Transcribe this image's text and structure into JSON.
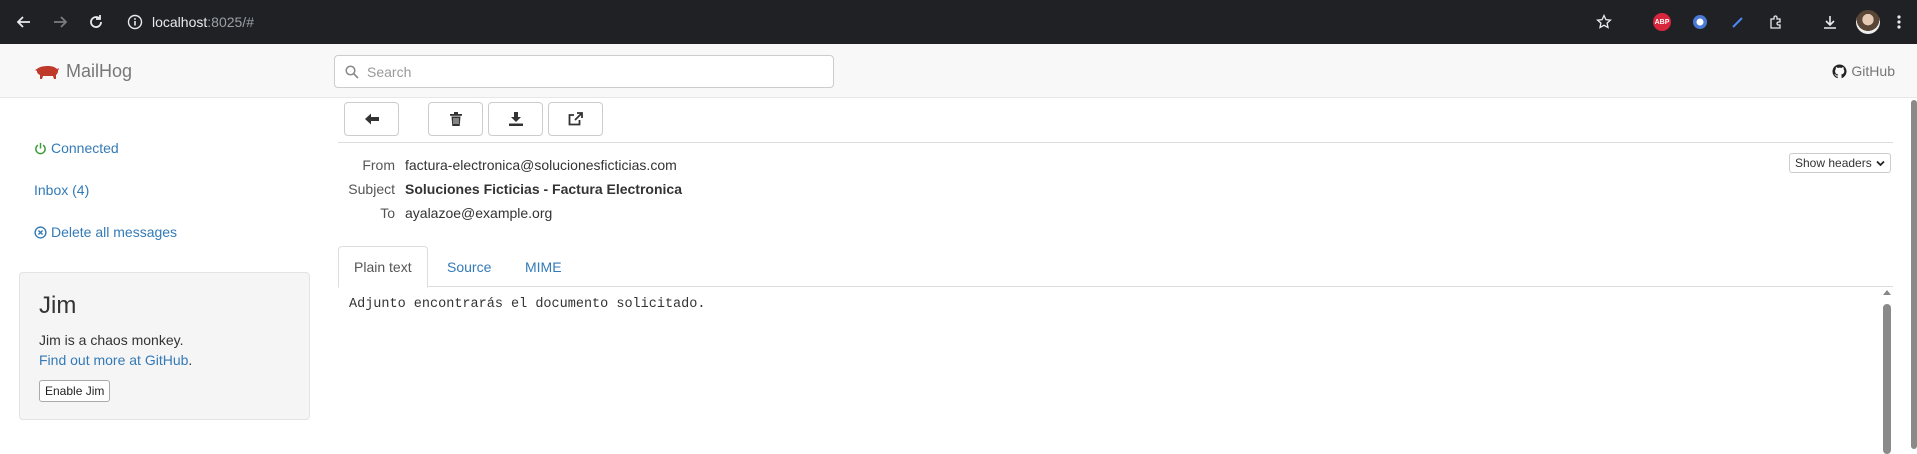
{
  "browser": {
    "url_host": "localhost",
    "url_rest": ":8025/#"
  },
  "app": {
    "brand": "MailHog",
    "search_placeholder": "Search",
    "github_label": "GitHub",
    "brand_color": "#c0392b",
    "link_color": "#337ab7"
  },
  "sidebar": {
    "connected_label": "Connected",
    "connected_color": "#3c9c3c",
    "inbox_label": "Inbox (4)",
    "delete_label": "Delete all messages"
  },
  "jim": {
    "title": "Jim",
    "description": "Jim is a chaos monkey.",
    "link_text": "Find out more at GitHub",
    "link_suffix": ".",
    "button_label": "Enable Jim"
  },
  "toolbar": {
    "buttons": [
      "back-arrow-icon",
      "trash-icon",
      "download-icon",
      "release-icon"
    ]
  },
  "message": {
    "from_label": "From",
    "from_value": "factura-electronica@solucionesficticias.com",
    "subject_label": "Subject",
    "subject_value": "Soluciones Ficticias - Factura Electronica",
    "to_label": "To",
    "to_value": "ayalazoe@example.org",
    "show_headers_label": "Show headers",
    "tabs": [
      "Plain text",
      "Source",
      "MIME"
    ],
    "active_tab": "Plain text",
    "body": "Adjunto encontrarás el documento solicitado."
  }
}
